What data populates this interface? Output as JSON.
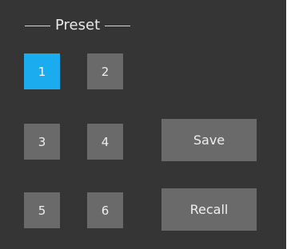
{
  "preset": {
    "title": "Preset",
    "slots": [
      {
        "label": "1",
        "selected": true
      },
      {
        "label": "2",
        "selected": false
      },
      {
        "label": "3",
        "selected": false
      },
      {
        "label": "4",
        "selected": false
      },
      {
        "label": "5",
        "selected": false
      },
      {
        "label": "6",
        "selected": false
      }
    ],
    "save_label": "Save",
    "recall_label": "Recall",
    "colors": {
      "panel": "#353535",
      "button": "#6a6a6a",
      "selected": "#1aacee"
    }
  }
}
